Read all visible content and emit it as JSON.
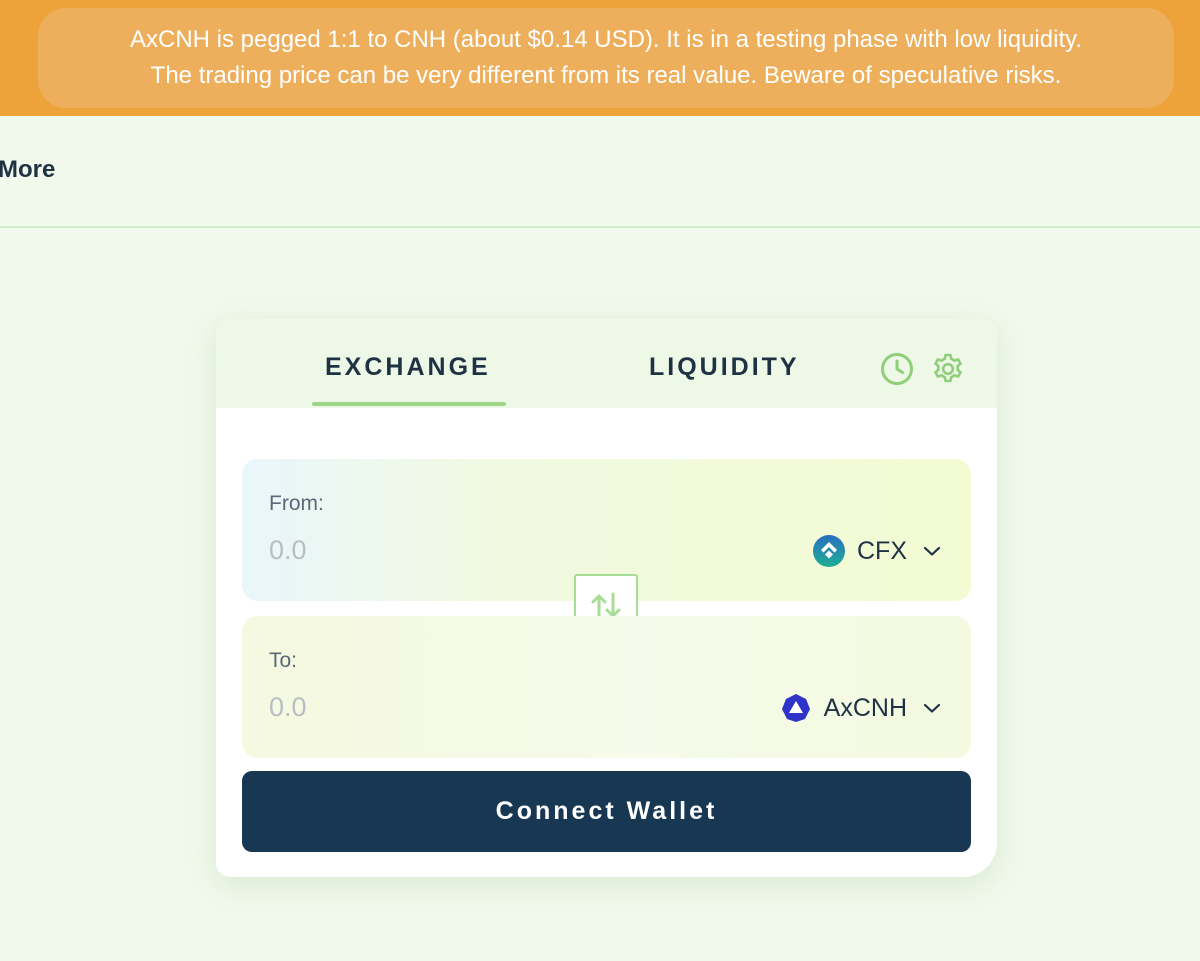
{
  "banner": {
    "line1": "AxCNH is pegged 1:1 to CNH (about $0.14 USD). It is in a testing phase with low liquidity.",
    "line2": "The trading price can be very different from its real value. Beware of speculative risks."
  },
  "nav": {
    "more_label": "More"
  },
  "tabs": {
    "exchange_label": "EXCHANGE",
    "liquidity_label": "LIQUIDITY",
    "active": "EXCHANGE"
  },
  "icons": {
    "history": "clock-icon",
    "settings": "gear-icon",
    "swap": "swap-arrows-icon",
    "dropdown": "chevron-down-icon"
  },
  "from": {
    "label": "From:",
    "amount_placeholder": "0.0",
    "token": "CFX"
  },
  "to": {
    "label": "To:",
    "amount_placeholder": "0.0",
    "token": "AxCNH"
  },
  "connect_button_label": "Connect Wallet",
  "colors": {
    "banner_background": "#eda33a",
    "page_background": "#f1f9ec",
    "accent_green": "#9dd688",
    "button_navy": "#173753"
  }
}
